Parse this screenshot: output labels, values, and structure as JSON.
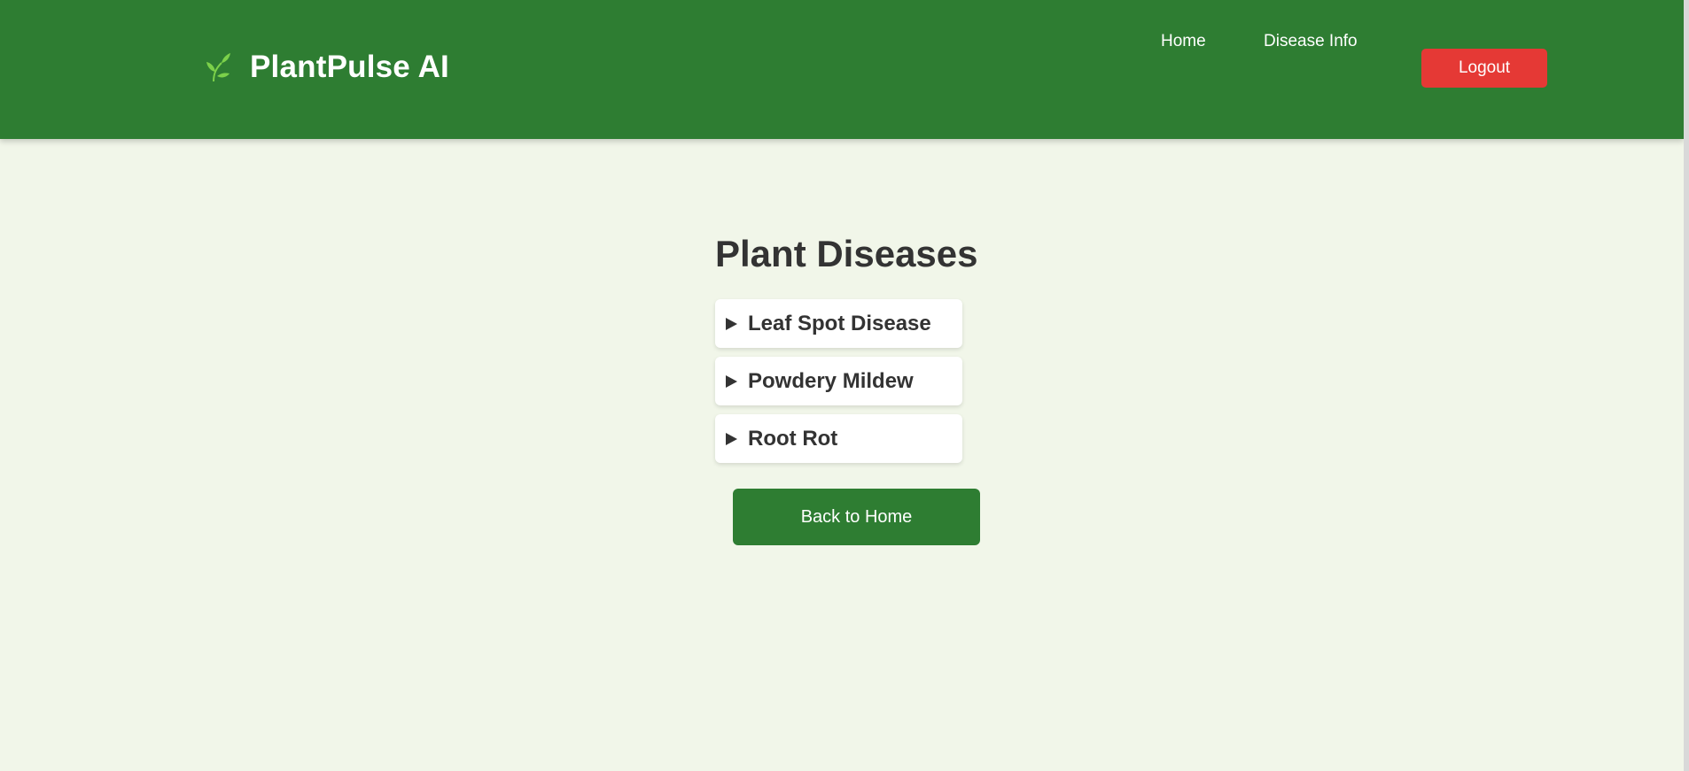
{
  "header": {
    "brand_title": "PlantPulse AI",
    "brand_icon": "leaf-sprout-icon",
    "nav": [
      {
        "label": "Home"
      },
      {
        "label": "Disease Info"
      }
    ],
    "logout_label": "Logout",
    "colors": {
      "header_bg": "#2e7d32",
      "logout_bg": "#e53935",
      "icon_green": "#7cd14a"
    }
  },
  "main": {
    "title": "Plant Diseases",
    "diseases": [
      {
        "label": "Leaf Spot Disease",
        "expanded": false
      },
      {
        "label": "Powdery Mildew",
        "expanded": false
      },
      {
        "label": "Root Rot",
        "expanded": false
      }
    ],
    "back_label": "Back to Home",
    "colors": {
      "page_bg": "#f1f6e9",
      "button_bg": "#2e7d32"
    }
  }
}
